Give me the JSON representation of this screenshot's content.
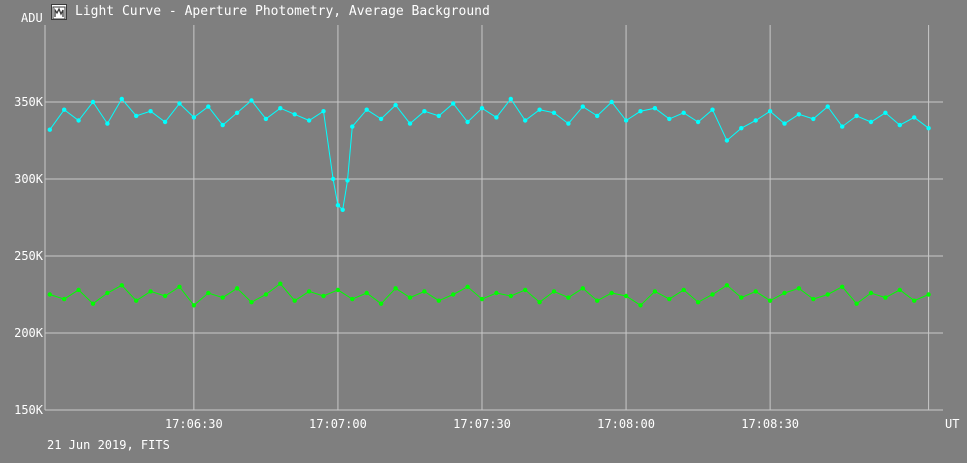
{
  "window": {
    "title": "Light Curve - Aperture Photometry, Average Background",
    "icon": "light-curve-app-icon"
  },
  "footer": {
    "caption": "21 Jun 2019, FITS"
  },
  "colors": {
    "background": "#7f7f7f",
    "grid": "#c8c8c8",
    "text": "#ffffff"
  },
  "chart_data": {
    "type": "scatter",
    "ylabel": "ADU",
    "xlabel": "UT",
    "ylim": [
      150000,
      400000
    ],
    "xlim": [
      "17:05:59",
      "17:09:06"
    ],
    "grid": true,
    "y_ticks": [
      {
        "value": 150000,
        "label": "150K"
      },
      {
        "value": 200000,
        "label": "200K"
      },
      {
        "value": 250000,
        "label": "250K"
      },
      {
        "value": 300000,
        "label": "300K"
      },
      {
        "value": 350000,
        "label": "350K"
      }
    ],
    "x_ticks": [
      {
        "value": "17:06:30",
        "label": "17:06:30"
      },
      {
        "value": "17:07:00",
        "label": "17:07:00"
      },
      {
        "value": "17:07:30",
        "label": "17:07:30"
      },
      {
        "value": "17:08:00",
        "label": "17:08:00"
      },
      {
        "value": "17:08:30",
        "label": "17:08:30"
      },
      {
        "value": "17:09:03",
        "label": ""
      }
    ],
    "series": [
      {
        "color": "#00ffff",
        "points": [
          [
            "17:06:00",
            332000
          ],
          [
            "17:06:03",
            345000
          ],
          [
            "17:06:06",
            338000
          ],
          [
            "17:06:09",
            350000
          ],
          [
            "17:06:12",
            336000
          ],
          [
            "17:06:15",
            352000
          ],
          [
            "17:06:18",
            341000
          ],
          [
            "17:06:21",
            344000
          ],
          [
            "17:06:24",
            337000
          ],
          [
            "17:06:27",
            349000
          ],
          [
            "17:06:30",
            340000
          ],
          [
            "17:06:33",
            347000
          ],
          [
            "17:06:36",
            335000
          ],
          [
            "17:06:39",
            343000
          ],
          [
            "17:06:42",
            351000
          ],
          [
            "17:06:45",
            339000
          ],
          [
            "17:06:48",
            346000
          ],
          [
            "17:06:51",
            342000
          ],
          [
            "17:06:54",
            338000
          ],
          [
            "17:06:57",
            344000
          ],
          [
            "17:06:59",
            300000
          ],
          [
            "17:07:00",
            283000
          ],
          [
            "17:07:01",
            280000
          ],
          [
            "17:07:02",
            299000
          ],
          [
            "17:07:03",
            334000
          ],
          [
            "17:07:06",
            345000
          ],
          [
            "17:07:09",
            339000
          ],
          [
            "17:07:12",
            348000
          ],
          [
            "17:07:15",
            336000
          ],
          [
            "17:07:18",
            344000
          ],
          [
            "17:07:21",
            341000
          ],
          [
            "17:07:24",
            349000
          ],
          [
            "17:07:27",
            337000
          ],
          [
            "17:07:30",
            346000
          ],
          [
            "17:07:33",
            340000
          ],
          [
            "17:07:36",
            352000
          ],
          [
            "17:07:39",
            338000
          ],
          [
            "17:07:42",
            345000
          ],
          [
            "17:07:45",
            343000
          ],
          [
            "17:07:48",
            336000
          ],
          [
            "17:07:51",
            347000
          ],
          [
            "17:07:54",
            341000
          ],
          [
            "17:07:57",
            350000
          ],
          [
            "17:08:00",
            338000
          ],
          [
            "17:08:03",
            344000
          ],
          [
            "17:08:06",
            346000
          ],
          [
            "17:08:09",
            339000
          ],
          [
            "17:08:12",
            343000
          ],
          [
            "17:08:15",
            337000
          ],
          [
            "17:08:18",
            345000
          ],
          [
            "17:08:21",
            325000
          ],
          [
            "17:08:24",
            333000
          ],
          [
            "17:08:27",
            338000
          ],
          [
            "17:08:30",
            344000
          ],
          [
            "17:08:33",
            336000
          ],
          [
            "17:08:36",
            342000
          ],
          [
            "17:08:39",
            339000
          ],
          [
            "17:08:42",
            347000
          ],
          [
            "17:08:45",
            334000
          ],
          [
            "17:08:48",
            341000
          ],
          [
            "17:08:51",
            337000
          ],
          [
            "17:08:54",
            343000
          ],
          [
            "17:08:57",
            335000
          ],
          [
            "17:09:00",
            340000
          ],
          [
            "17:09:03",
            333000
          ]
        ]
      },
      {
        "color": "#00ff00",
        "points": [
          [
            "17:06:00",
            225000
          ],
          [
            "17:06:03",
            222000
          ],
          [
            "17:06:06",
            228000
          ],
          [
            "17:06:09",
            219000
          ],
          [
            "17:06:12",
            226000
          ],
          [
            "17:06:15",
            231000
          ],
          [
            "17:06:18",
            221000
          ],
          [
            "17:06:21",
            227000
          ],
          [
            "17:06:24",
            224000
          ],
          [
            "17:06:27",
            230000
          ],
          [
            "17:06:30",
            218000
          ],
          [
            "17:06:33",
            226000
          ],
          [
            "17:06:36",
            223000
          ],
          [
            "17:06:39",
            229000
          ],
          [
            "17:06:42",
            220000
          ],
          [
            "17:06:45",
            225000
          ],
          [
            "17:06:48",
            232000
          ],
          [
            "17:06:51",
            221000
          ],
          [
            "17:06:54",
            227000
          ],
          [
            "17:06:57",
            224000
          ],
          [
            "17:07:00",
            228000
          ],
          [
            "17:07:03",
            222000
          ],
          [
            "17:07:06",
            226000
          ],
          [
            "17:07:09",
            219000
          ],
          [
            "17:07:12",
            229000
          ],
          [
            "17:07:15",
            223000
          ],
          [
            "17:07:18",
            227000
          ],
          [
            "17:07:21",
            221000
          ],
          [
            "17:07:24",
            225000
          ],
          [
            "17:07:27",
            230000
          ],
          [
            "17:07:30",
            222000
          ],
          [
            "17:07:33",
            226000
          ],
          [
            "17:07:36",
            224000
          ],
          [
            "17:07:39",
            228000
          ],
          [
            "17:07:42",
            220000
          ],
          [
            "17:07:45",
            227000
          ],
          [
            "17:07:48",
            223000
          ],
          [
            "17:07:51",
            229000
          ],
          [
            "17:07:54",
            221000
          ],
          [
            "17:07:57",
            226000
          ],
          [
            "17:08:00",
            224000
          ],
          [
            "17:08:03",
            218000
          ],
          [
            "17:08:06",
            227000
          ],
          [
            "17:08:09",
            222000
          ],
          [
            "17:08:12",
            228000
          ],
          [
            "17:08:15",
            220000
          ],
          [
            "17:08:18",
            225000
          ],
          [
            "17:08:21",
            231000
          ],
          [
            "17:08:24",
            223000
          ],
          [
            "17:08:27",
            227000
          ],
          [
            "17:08:30",
            221000
          ],
          [
            "17:08:33",
            226000
          ],
          [
            "17:08:36",
            229000
          ],
          [
            "17:08:39",
            222000
          ],
          [
            "17:08:42",
            225000
          ],
          [
            "17:08:45",
            230000
          ],
          [
            "17:08:48",
            219000
          ],
          [
            "17:08:51",
            226000
          ],
          [
            "17:08:54",
            223000
          ],
          [
            "17:08:57",
            228000
          ],
          [
            "17:09:00",
            221000
          ],
          [
            "17:09:03",
            225000
          ]
        ]
      }
    ]
  }
}
